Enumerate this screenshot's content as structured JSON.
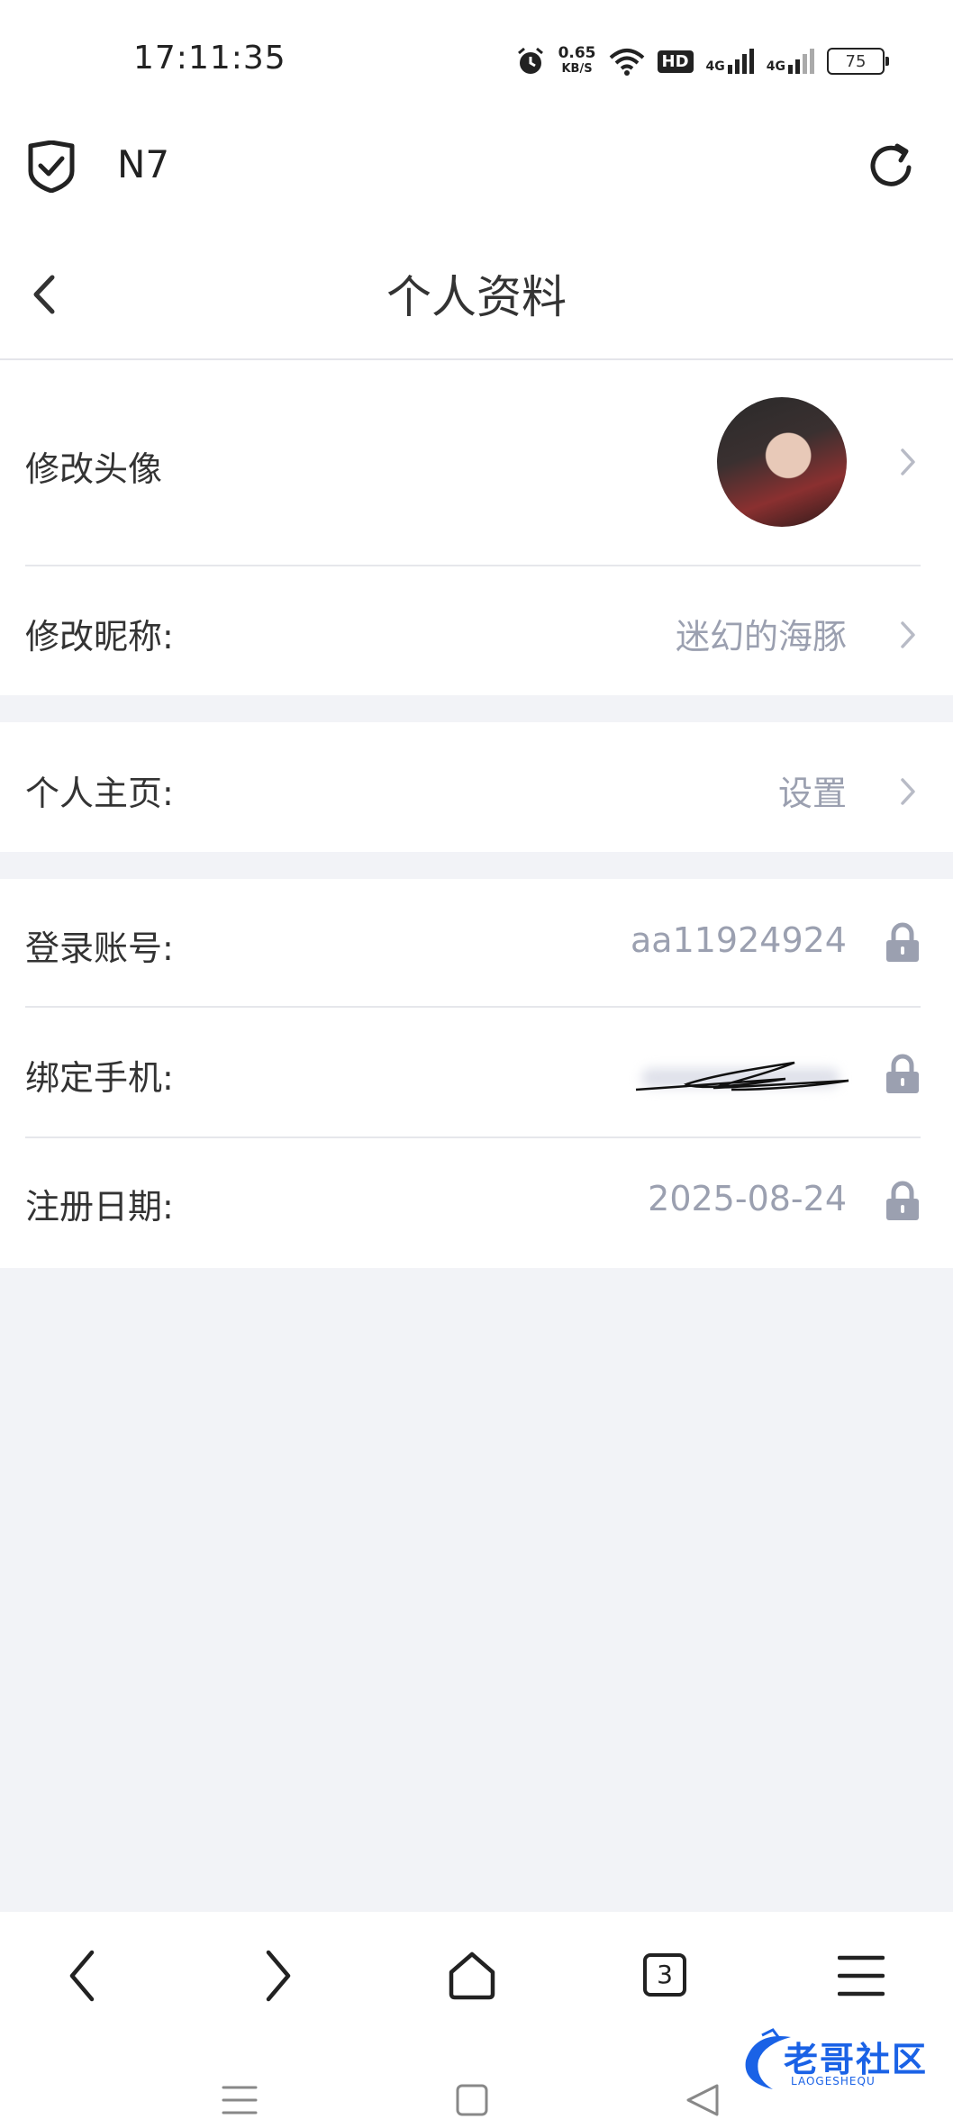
{
  "status_bar": {
    "time": "17:11:35",
    "net_speed_value": "0.65",
    "net_speed_unit": "KB/S",
    "hd_badge": "HD",
    "signal_1": "4G",
    "signal_2": "4G",
    "battery": "75"
  },
  "browser": {
    "site_name": "N7",
    "tab_count": "3"
  },
  "page": {
    "title": "个人资料"
  },
  "profile": {
    "avatar_label": "修改头像",
    "nickname_label": "修改昵称:",
    "nickname_value": "迷幻的海豚",
    "homepage_label": "个人主页:",
    "homepage_value": "设置",
    "account_label": "登录账号:",
    "account_value": "aa11924924",
    "phone_label": "绑定手机:",
    "register_label": "注册日期:",
    "register_value": "2025-08-24"
  },
  "watermark": {
    "text": "老哥社区",
    "subtext": "LAOGESHEQU"
  },
  "colors": {
    "page_bg": "#f2f3f7",
    "value_text": "#9ba0b0",
    "lock": "#9ba0b0",
    "watermark": "#1a62e6"
  }
}
